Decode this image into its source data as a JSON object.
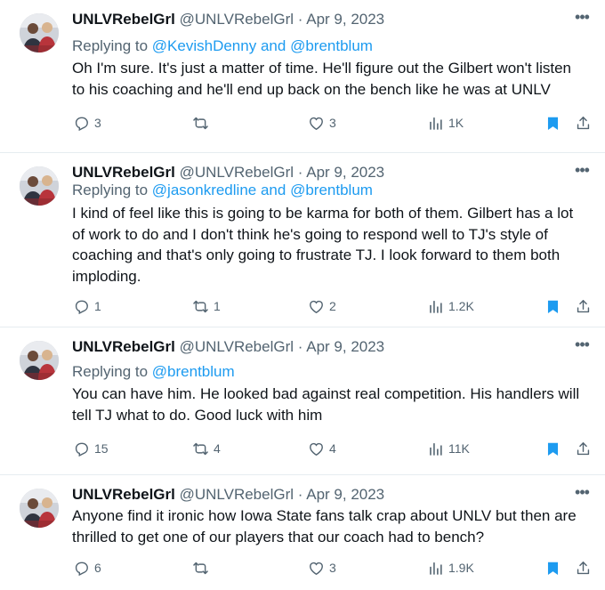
{
  "tweets": [
    {
      "name": "UNLVRebelGrl",
      "handle": "@UNLVRebelGrl",
      "dot": "·",
      "date": "Apr 9, 2023",
      "replying_prefix": "Replying to",
      "replying_a": "@KevishDenny",
      "replying_and": "and",
      "replying_b": "@brentblum",
      "text": "Oh I'm sure. It's just a matter of time. He'll figure out the Gilbert won't listen to his coaching and he'll end up back on the bench like he was at UNLV",
      "replies": "3",
      "retweets": "",
      "likes": "3",
      "views": "1K"
    },
    {
      "name": "UNLVRebelGrl",
      "handle": "@UNLVRebelGrl",
      "dot": "·",
      "date": "Apr 9, 2023",
      "replying_prefix": "Replying to",
      "replying_a": "@jasonkredline",
      "replying_and": "and",
      "replying_b": "@brentblum",
      "text": "I kind of feel like this is going to be karma for both of them. Gilbert has a lot of work to do and I don't think he's going to respond well to TJ's style of coaching and that's only going to frustrate TJ. I look forward to them both imploding.",
      "replies": "1",
      "retweets": "1",
      "likes": "2",
      "views": "1.2K"
    },
    {
      "name": "UNLVRebelGrl",
      "handle": "@UNLVRebelGrl",
      "dot": "·",
      "date": "Apr 9, 2023",
      "replying_prefix": "Replying to",
      "replying_a": "@brentblum",
      "text": "You can have him. He looked bad against real competition. His handlers will tell TJ what to do. Good luck with him",
      "replies": "15",
      "retweets": "4",
      "likes": "4",
      "views": "11K"
    },
    {
      "name": "UNLVRebelGrl",
      "handle": "@UNLVRebelGrl",
      "dot": "·",
      "date": "Apr 9, 2023",
      "text": "Anyone find it ironic how Iowa State fans talk crap about UNLV but then are thrilled to get one of our players that our coach had to bench?",
      "replies": "6",
      "retweets": "",
      "likes": "3",
      "views": "1.9K"
    }
  ],
  "colors": {
    "accent": "#1d9bf0",
    "muted": "#536471",
    "text": "#0f1419"
  },
  "icons": [
    "more-icon",
    "reply-icon",
    "retweet-icon",
    "like-icon",
    "views-icon",
    "bookmark-icon",
    "share-icon"
  ]
}
